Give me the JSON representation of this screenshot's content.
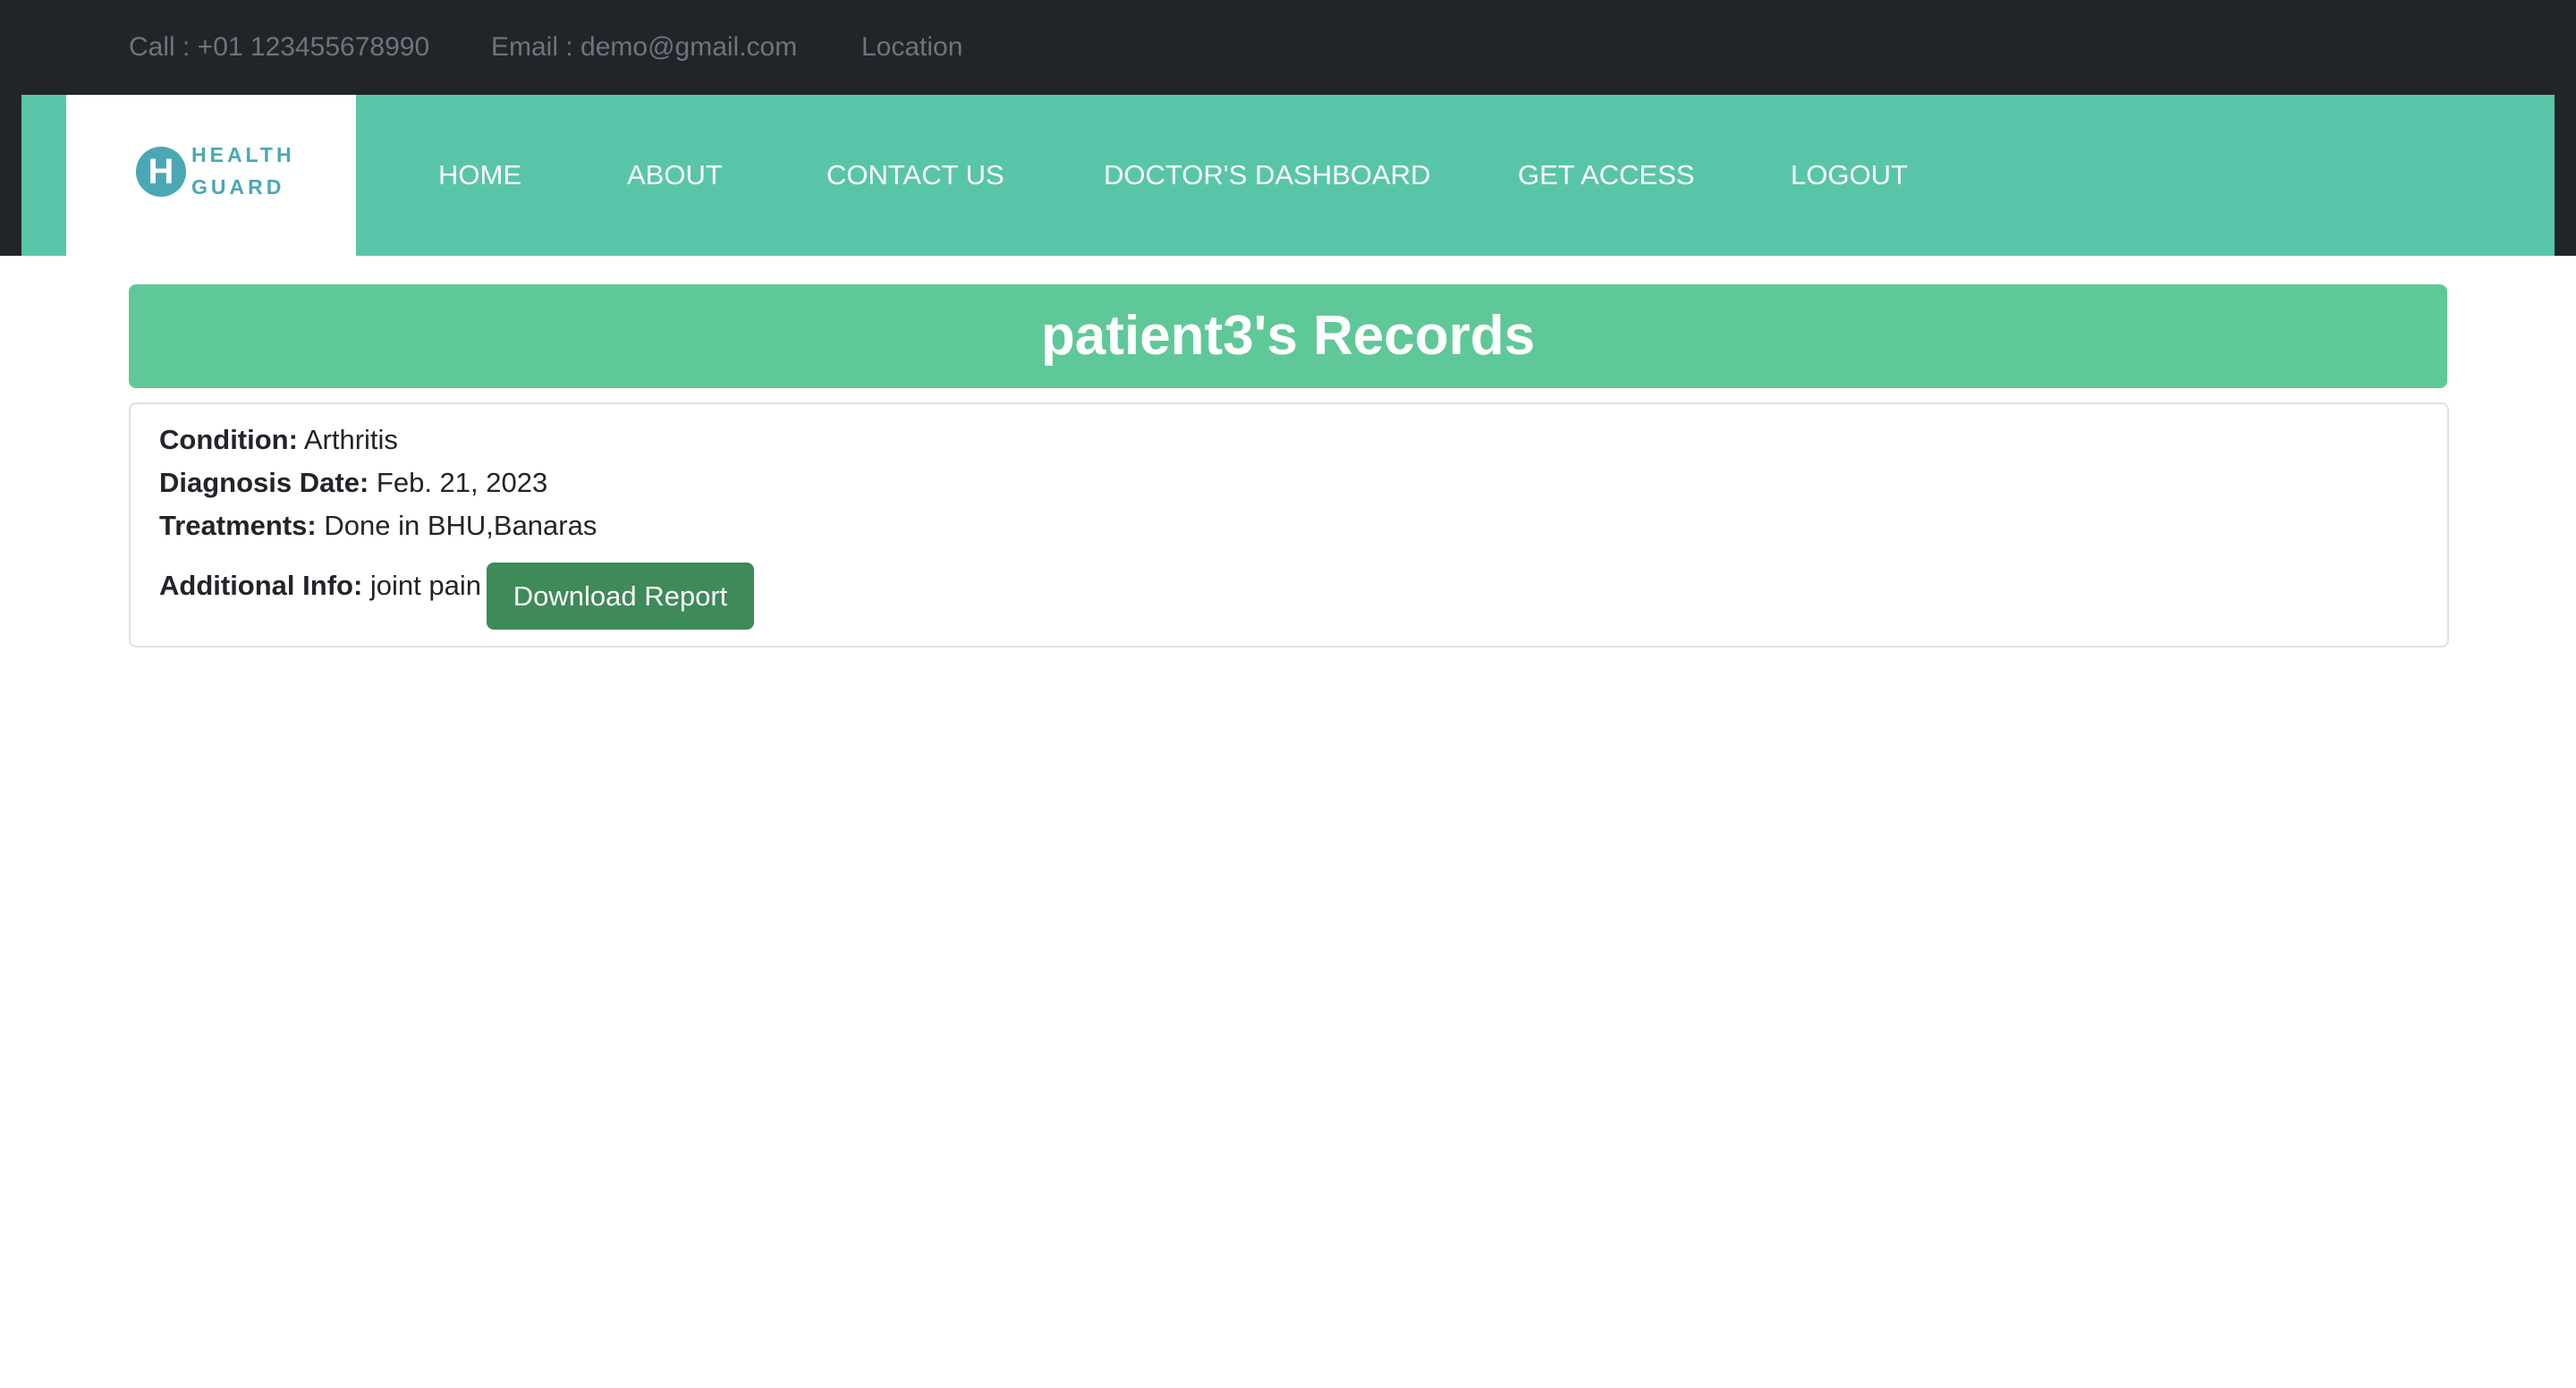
{
  "topbar": {
    "call": "Call : +01 123455678990",
    "email": "Email : demo@gmail.com",
    "location": "Location"
  },
  "logo": {
    "letter": "H",
    "line1": "HEALTH",
    "line2": "GUARD"
  },
  "nav": {
    "items": [
      {
        "label": "HOME"
      },
      {
        "label": "ABOUT"
      },
      {
        "label": "CONTACT US"
      },
      {
        "label": "DOCTOR'S DASHBOARD"
      },
      {
        "label": "GET ACCESS"
      },
      {
        "label": "LOGOUT"
      }
    ]
  },
  "page": {
    "title": "patient3's Records"
  },
  "record": {
    "condition_label": "Condition:",
    "condition": "Arthritis",
    "diagnosis_label": "Diagnosis Date:",
    "diagnosis": "Feb. 21, 2023",
    "treatments_label": "Treatments:",
    "treatments": "Done in BHU,Banaras",
    "info_label": "Additional Info:",
    "info": "joint pain",
    "download_label": "Download Report"
  },
  "colors": {
    "topbar": "#212529",
    "nav": "#59c5a8",
    "title_bar": "#5fc898",
    "button": "#3e8a58",
    "logo": "#4aa8b4"
  }
}
